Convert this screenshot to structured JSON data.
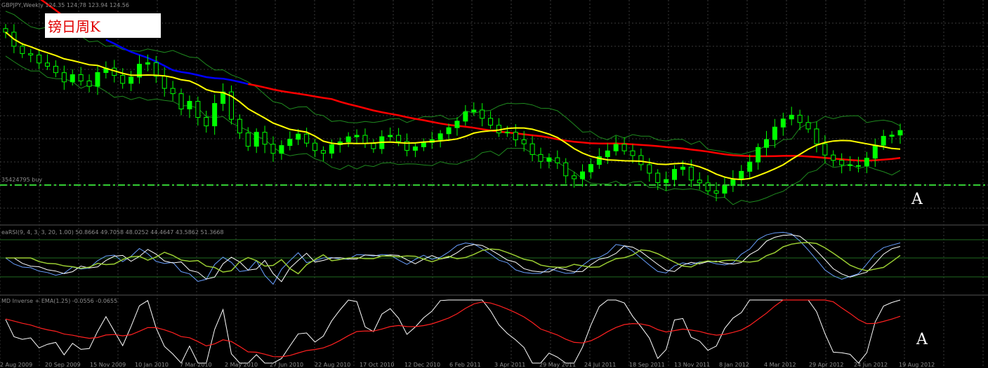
{
  "header": {
    "symbol_line": "GBPJPY,Weekly  124.35 124.78 123.94 124.56",
    "line_label": "35424795 buy",
    "rsi_line": "eaRSI(9, 4, 3, 3, 20, 1.00) 50.8664 49.7058 48.0252 44.4647 43.5862 51.3668",
    "inv_line": "MD Inverse + EMA(1.25) -0.0556 -0.0655"
  },
  "title": "镑日周K",
  "markers": [
    "A",
    "A"
  ],
  "colors": {
    "bull": "#00ff00",
    "bear": "#00ff00",
    "ma_fast": "#ffff00",
    "ma_slow_red": "#ff0000",
    "ma_slow_blue": "#0000ff",
    "bands": "#1f8a1f",
    "hline": "#33cc33",
    "inv": "#ffffff",
    "inv_ema": "#ff2020"
  },
  "chart_data": {
    "type": "line",
    "xticks": [
      "2 Aug 2009",
      "20 Sep 2009",
      "15 Nov 2009",
      "10 Jan 2010",
      "7 Mar 2010",
      "2 May 2010",
      "27 Jun 2010",
      "22 Aug 2010",
      "17 Oct 2010",
      "12 Dec 2010",
      "6 Feb 2011",
      "3 Apr 2011",
      "29 May 2011",
      "24 Jul 2011",
      "18 Sep 2011",
      "13 Nov 2011",
      "8 Jan 2012",
      "4 Mar 2012",
      "29 Apr 2012",
      "24 Jun 2012",
      "19 Aug 2012"
    ],
    "price": [
      153,
      148,
      147,
      146,
      144,
      143,
      141,
      139,
      142,
      140,
      138,
      142,
      144,
      141,
      139,
      140,
      143,
      144,
      140,
      137,
      135,
      131,
      133,
      130,
      128,
      134,
      137,
      130,
      126,
      122,
      124,
      121,
      119,
      121,
      123,
      124,
      121,
      119,
      120,
      122,
      123,
      124,
      125,
      123,
      121,
      123,
      124,
      122,
      120,
      121,
      122,
      123,
      125,
      127,
      129,
      131,
      132,
      130,
      128,
      126,
      125,
      123,
      121,
      119,
      117,
      118,
      116,
      114,
      113,
      115,
      117,
      119,
      121,
      123,
      121,
      118,
      116,
      113,
      111,
      112,
      114,
      115,
      113,
      112,
      110,
      109,
      111,
      113,
      115,
      117,
      120,
      123,
      126,
      128,
      129,
      127,
      125,
      123,
      120,
      118,
      117,
      116,
      117,
      119,
      121,
      123,
      124,
      125
    ]
  }
}
